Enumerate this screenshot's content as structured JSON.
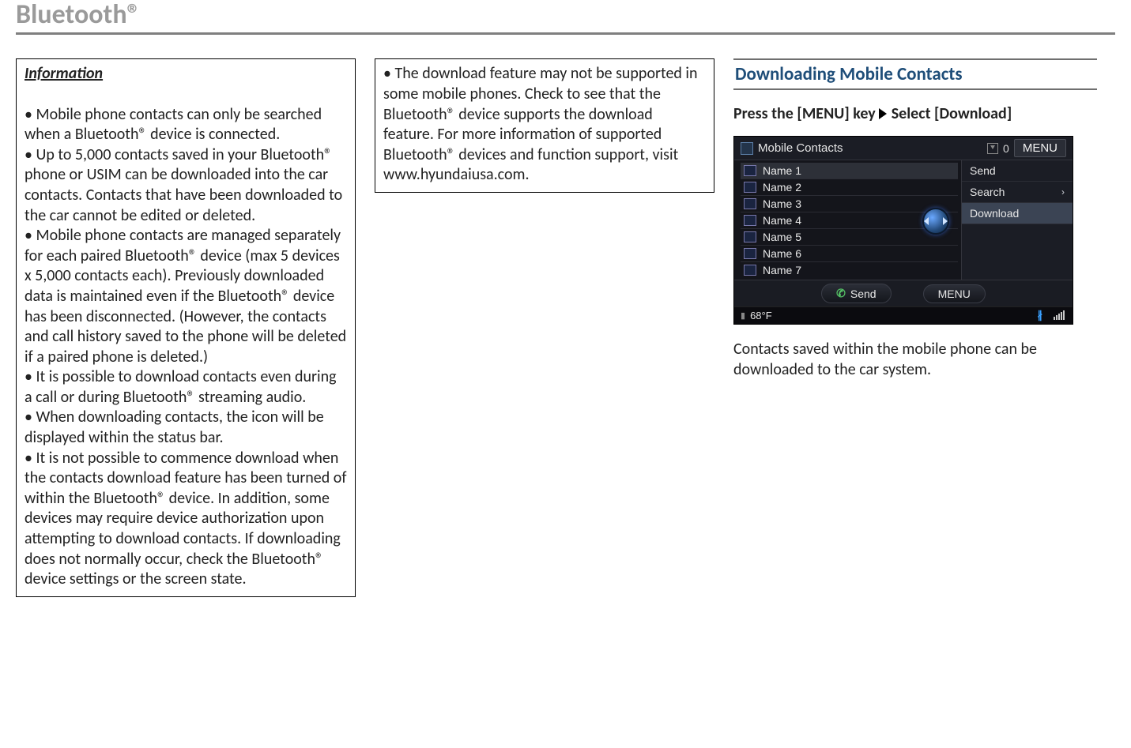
{
  "page_title": "Bluetooth®",
  "column1": {
    "info_label": "Information",
    "body": "\n• Mobile phone contacts can only be searched when a Bluetooth® device is connected.\n• Up to 5,000 contacts saved in your Bluetooth® phone or USIM can be downloaded into the car contacts. Contacts that have been downloaded to the car cannot be edited or deleted.\n• Mobile phone contacts are managed separately for each paired Bluetooth® device (max 5 devices x 5,000 contacts each). Previously downloaded data is maintained even if the Bluetooth® device has been disconnected. (However, the contacts and call history saved to the phone will be deleted if a paired phone is deleted.)\n• It is possible to download contacts even during a call or during Bluetooth® streaming audio.\n• When downloading contacts, the icon will be displayed within the status bar.\n• It is not possible to commence download when the contacts download feature has been turned of within the Bluetooth® device. In addition, some devices may require device authorization upon attempting to download contacts. If downloading does not normally occur, check the Bluetooth® device settings or the screen state."
  },
  "column2": {
    "body": "• The download feature may not be supported in some mobile phones. Check to see that the Bluetooth® device supports the download feature. For more information of supported Bluetooth® devices and function support, visit www.hyundaiusa.com."
  },
  "column3": {
    "heading": "Downloading Mobile Contacts",
    "instruction_a": "Press the [MENU] key",
    "instruction_b": "Select [Download]",
    "caption": "Contacts saved within the mobile phone can be downloaded to the car system."
  },
  "screen": {
    "header_title": "Mobile Contacts",
    "header_count": "0",
    "menu_label": "MENU",
    "contacts": [
      "Name 1",
      "Name 2",
      "Name 3",
      "Name 4",
      "Name 5",
      "Name 6",
      "Name 7"
    ],
    "menu_items": [
      {
        "label": "Send",
        "chevron": false,
        "highlight": false
      },
      {
        "label": "Search",
        "chevron": true,
        "highlight": false
      },
      {
        "label": "Download",
        "chevron": false,
        "highlight": true
      }
    ],
    "soft_send": "Send",
    "soft_menu": "MENU",
    "temperature": "68°F"
  }
}
